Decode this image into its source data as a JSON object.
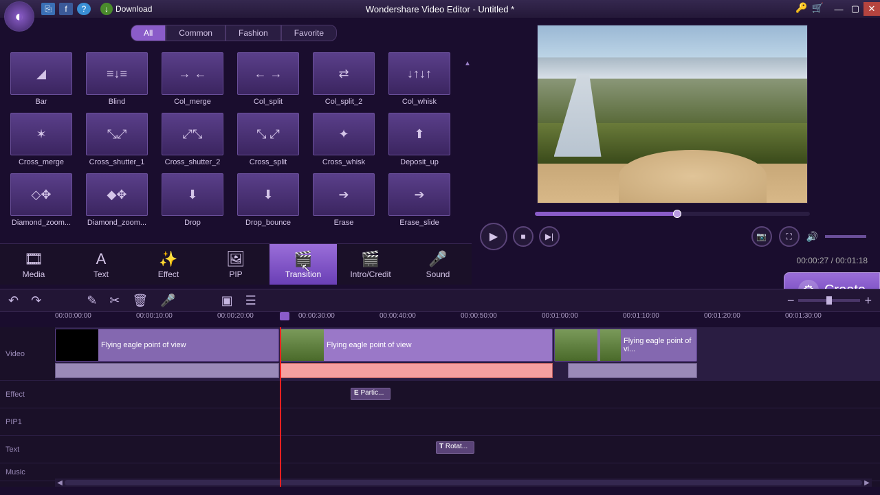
{
  "titlebar": {
    "title": "Wondershare Video Editor - Untitled *",
    "download": "Download"
  },
  "cat_tabs": [
    "All",
    "Common",
    "Fashion",
    "Favorite"
  ],
  "cat_active": 0,
  "transitions": [
    {
      "label": "Bar",
      "glyph": "◢"
    },
    {
      "label": "Blind",
      "glyph": "≡↓≡"
    },
    {
      "label": "Col_merge",
      "glyph": "→ ←"
    },
    {
      "label": "Col_split",
      "glyph": "← →"
    },
    {
      "label": "Col_split_2",
      "glyph": "⇄"
    },
    {
      "label": "Col_whisk",
      "glyph": "↓↑↓↑"
    },
    {
      "label": "Cross_merge",
      "glyph": "✶"
    },
    {
      "label": "Cross_shutter_1",
      "glyph": "⤡⤢"
    },
    {
      "label": "Cross_shutter_2",
      "glyph": "⤢⤡"
    },
    {
      "label": "Cross_split",
      "glyph": "⤡ ⤢"
    },
    {
      "label": "Cross_whisk",
      "glyph": "✦"
    },
    {
      "label": "Deposit_up",
      "glyph": "⬆"
    },
    {
      "label": "Diamond_zoom...",
      "glyph": "◇✥"
    },
    {
      "label": "Diamond_zoom...",
      "glyph": "◆✥"
    },
    {
      "label": "Drop",
      "glyph": "⬇"
    },
    {
      "label": "Drop_bounce",
      "glyph": "⬇"
    },
    {
      "label": "Erase",
      "glyph": "➔"
    },
    {
      "label": "Erase_slide",
      "glyph": "➔"
    }
  ],
  "module_tabs": [
    {
      "label": "Media",
      "icon": "🎞"
    },
    {
      "label": "Text",
      "icon": "A"
    },
    {
      "label": "Effect",
      "icon": "✨"
    },
    {
      "label": "PIP",
      "icon": "🖼"
    },
    {
      "label": "Transition",
      "icon": "🎬"
    },
    {
      "label": "Intro/Credit",
      "icon": "🎬"
    },
    {
      "label": "Sound",
      "icon": "🎤"
    }
  ],
  "module_active": 4,
  "preview": {
    "time_current": "00:00:27",
    "time_total": "00:01:18",
    "progress_pct": 52
  },
  "create_label": "Create",
  "ruler_marks": [
    "00:00:00:00",
    "00:00:10:00",
    "00:00:20:00",
    "00:00:30:00",
    "00:00:40:00",
    "00:00:50:00",
    "00:01:00:00",
    "00:01:10:00",
    "00:01:20:00",
    "00:01:30:00"
  ],
  "tracks": {
    "video": "Video",
    "effect": "Effect",
    "pip": "PIP1",
    "text": "Text",
    "music": "Music"
  },
  "clips": {
    "v1_label": "Flying eagle point of view",
    "v2_label": "Flying eagle point of view",
    "v3_label": "Flying eagle point of vi...",
    "effect_label": "Partic...",
    "effect_prefix": "E",
    "text_label": "Rotat...",
    "text_prefix": "T"
  }
}
